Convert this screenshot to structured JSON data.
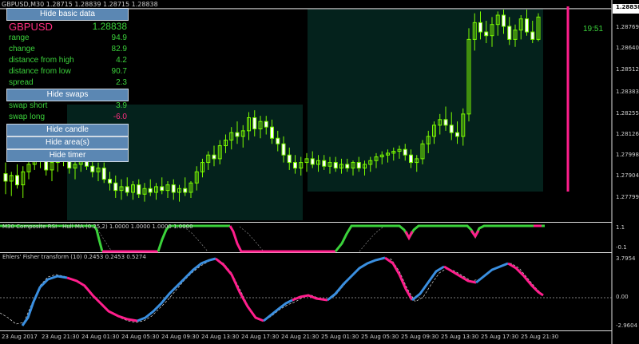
{
  "chart_header": "GBPUSD,M30  1.28715 1.28839 1.28715 1.28838",
  "timer": "19:51",
  "colors": {
    "bull": "#7cfc00",
    "bear": "#ffffff",
    "up_line": "#3a8fe0",
    "down_line": "#ff1e8c",
    "flag": "#ff1e8c",
    "price_box": "#ffffff",
    "box_fill": "#04221c"
  },
  "panel": {
    "hide_basic_label": "Hide basic data",
    "symbol": "GBPUSD",
    "symbol_price": "1.28838",
    "rows": [
      {
        "label": "range",
        "value": "94.9"
      },
      {
        "label": "change",
        "value": "82.9"
      },
      {
        "label": "distance from high",
        "value": "4.2"
      },
      {
        "label": "distance from low",
        "value": "90.7"
      },
      {
        "label": "spread",
        "value": "2.3"
      }
    ],
    "hide_swaps_label": "Hide swaps",
    "swap_short_label": "swap short",
    "swap_short_value": "3.9",
    "swap_long_label": "swap long",
    "swap_long_value": "-6.0",
    "hide_candle_label": "Hide candle",
    "hide_areas_label": "Hide area(s)",
    "hide_timer_label": "Hide timer"
  },
  "price_axis": {
    "current": "1.28838",
    "labels": [
      "1.28769",
      "1.28640",
      "1.28512",
      "1.28383",
      "1.28255",
      "1.28126",
      "1.27998",
      "1.27904",
      "1.27799"
    ]
  },
  "subpanel1": {
    "title": "M30 Composite RSI - Hull MA (0.25,2) 1.0000 1.0000 1.0000 1.0000",
    "levels": [
      "1.1",
      "-0.1"
    ]
  },
  "subpanel2": {
    "title": "Ehlers' Fisher transform (10) 0.2453 0.2453 0.5274",
    "levels": [
      "3.7954",
      "0.00",
      "-2.9604"
    ]
  },
  "time_labels": [
    "23 Aug 2017",
    "23 Aug 21:30",
    "24 Aug 01:30",
    "24 Aug 05:30",
    "24 Aug 09:30",
    "24 Aug 13:30",
    "24 Aug 17:30",
    "24 Aug 21:30",
    "25 Aug 01:30",
    "25 Aug 05:30",
    "25 Aug 09:30",
    "25 Aug 13:30",
    "25 Aug 17:30",
    "25 Aug 21:30"
  ],
  "chart_data": {
    "type": "candlestick",
    "symbol": "GBPUSD",
    "timeframe": "M30",
    "ylim": [
      1.2775,
      1.2888
    ],
    "last_close": 1.28838,
    "candles": [
      {
        "o": 1.28,
        "h": 1.2806,
        "l": 1.2789,
        "c": 1.2796
      },
      {
        "o": 1.2796,
        "h": 1.2801,
        "l": 1.2788,
        "c": 1.2799
      },
      {
        "o": 1.2799,
        "h": 1.2805,
        "l": 1.2792,
        "c": 1.2794
      },
      {
        "o": 1.2794,
        "h": 1.2804,
        "l": 1.2787,
        "c": 1.2801
      },
      {
        "o": 1.2801,
        "h": 1.2811,
        "l": 1.2797,
        "c": 1.2805
      },
      {
        "o": 1.2805,
        "h": 1.2816,
        "l": 1.2802,
        "c": 1.2812
      },
      {
        "o": 1.2812,
        "h": 1.2818,
        "l": 1.2803,
        "c": 1.2808
      },
      {
        "o": 1.2808,
        "h": 1.2812,
        "l": 1.2799,
        "c": 1.2802
      },
      {
        "o": 1.2802,
        "h": 1.2809,
        "l": 1.2796,
        "c": 1.2806
      },
      {
        "o": 1.2806,
        "h": 1.2814,
        "l": 1.2801,
        "c": 1.281
      },
      {
        "o": 1.281,
        "h": 1.2816,
        "l": 1.2804,
        "c": 1.2807
      },
      {
        "o": 1.2807,
        "h": 1.2811,
        "l": 1.28,
        "c": 1.2803
      },
      {
        "o": 1.2803,
        "h": 1.2808,
        "l": 1.2797,
        "c": 1.2805
      },
      {
        "o": 1.2805,
        "h": 1.2811,
        "l": 1.2801,
        "c": 1.2808
      },
      {
        "o": 1.2808,
        "h": 1.2812,
        "l": 1.2802,
        "c": 1.2804
      },
      {
        "o": 1.2804,
        "h": 1.2808,
        "l": 1.2798,
        "c": 1.2801
      },
      {
        "o": 1.2801,
        "h": 1.2806,
        "l": 1.2796,
        "c": 1.2803
      },
      {
        "o": 1.2803,
        "h": 1.2806,
        "l": 1.2795,
        "c": 1.2797
      },
      {
        "o": 1.2797,
        "h": 1.2801,
        "l": 1.2791,
        "c": 1.2795
      },
      {
        "o": 1.2795,
        "h": 1.2799,
        "l": 1.2787,
        "c": 1.2791
      },
      {
        "o": 1.2791,
        "h": 1.2797,
        "l": 1.2786,
        "c": 1.2793
      },
      {
        "o": 1.2793,
        "h": 1.2798,
        "l": 1.2788,
        "c": 1.279
      },
      {
        "o": 1.279,
        "h": 1.2796,
        "l": 1.2786,
        "c": 1.2794
      },
      {
        "o": 1.2794,
        "h": 1.2797,
        "l": 1.2787,
        "c": 1.2789
      },
      {
        "o": 1.2789,
        "h": 1.2795,
        "l": 1.2785,
        "c": 1.2792
      },
      {
        "o": 1.2792,
        "h": 1.2797,
        "l": 1.2788,
        "c": 1.279
      },
      {
        "o": 1.279,
        "h": 1.2795,
        "l": 1.2786,
        "c": 1.2793
      },
      {
        "o": 1.2793,
        "h": 1.2798,
        "l": 1.2789,
        "c": 1.2791
      },
      {
        "o": 1.2791,
        "h": 1.2796,
        "l": 1.2787,
        "c": 1.2794
      },
      {
        "o": 1.2794,
        "h": 1.2797,
        "l": 1.2786,
        "c": 1.279
      },
      {
        "o": 1.279,
        "h": 1.2794,
        "l": 1.2785,
        "c": 1.2792
      },
      {
        "o": 1.2792,
        "h": 1.2798,
        "l": 1.2788,
        "c": 1.279
      },
      {
        "o": 1.279,
        "h": 1.2796,
        "l": 1.2787,
        "c": 1.2795
      },
      {
        "o": 1.2795,
        "h": 1.2804,
        "l": 1.2791,
        "c": 1.2801
      },
      {
        "o": 1.2801,
        "h": 1.2808,
        "l": 1.2798,
        "c": 1.2806
      },
      {
        "o": 1.2806,
        "h": 1.2812,
        "l": 1.2802,
        "c": 1.281
      },
      {
        "o": 1.281,
        "h": 1.2815,
        "l": 1.2804,
        "c": 1.2808
      },
      {
        "o": 1.2808,
        "h": 1.2818,
        "l": 1.2805,
        "c": 1.2815
      },
      {
        "o": 1.2815,
        "h": 1.2821,
        "l": 1.2811,
        "c": 1.2818
      },
      {
        "o": 1.2818,
        "h": 1.2825,
        "l": 1.2813,
        "c": 1.2822
      },
      {
        "o": 1.2822,
        "h": 1.2828,
        "l": 1.2816,
        "c": 1.282
      },
      {
        "o": 1.282,
        "h": 1.2826,
        "l": 1.2814,
        "c": 1.2823
      },
      {
        "o": 1.2823,
        "h": 1.2833,
        "l": 1.2818,
        "c": 1.283
      },
      {
        "o": 1.283,
        "h": 1.2834,
        "l": 1.282,
        "c": 1.2824
      },
      {
        "o": 1.2824,
        "h": 1.2831,
        "l": 1.2819,
        "c": 1.2828
      },
      {
        "o": 1.2828,
        "h": 1.2831,
        "l": 1.2821,
        "c": 1.2825
      },
      {
        "o": 1.2825,
        "h": 1.2829,
        "l": 1.2816,
        "c": 1.2819
      },
      {
        "o": 1.2819,
        "h": 1.2823,
        "l": 1.2812,
        "c": 1.2816
      },
      {
        "o": 1.2816,
        "h": 1.282,
        "l": 1.2806,
        "c": 1.281
      },
      {
        "o": 1.281,
        "h": 1.2814,
        "l": 1.2802,
        "c": 1.2806
      },
      {
        "o": 1.2806,
        "h": 1.281,
        "l": 1.28,
        "c": 1.2803
      },
      {
        "o": 1.2803,
        "h": 1.2809,
        "l": 1.2799,
        "c": 1.2806
      },
      {
        "o": 1.2806,
        "h": 1.2811,
        "l": 1.2801,
        "c": 1.2808
      },
      {
        "o": 1.2808,
        "h": 1.2812,
        "l": 1.2803,
        "c": 1.2805
      },
      {
        "o": 1.2805,
        "h": 1.281,
        "l": 1.2801,
        "c": 1.2807
      },
      {
        "o": 1.2807,
        "h": 1.281,
        "l": 1.2802,
        "c": 1.2804
      },
      {
        "o": 1.2804,
        "h": 1.2809,
        "l": 1.28,
        "c": 1.2806
      },
      {
        "o": 1.2806,
        "h": 1.2809,
        "l": 1.2801,
        "c": 1.2803
      },
      {
        "o": 1.2803,
        "h": 1.2808,
        "l": 1.28,
        "c": 1.2805
      },
      {
        "o": 1.2805,
        "h": 1.2808,
        "l": 1.2801,
        "c": 1.2803
      },
      {
        "o": 1.2803,
        "h": 1.2807,
        "l": 1.2799,
        "c": 1.2806
      },
      {
        "o": 1.2806,
        "h": 1.2809,
        "l": 1.2801,
        "c": 1.2803
      },
      {
        "o": 1.2803,
        "h": 1.2807,
        "l": 1.2799,
        "c": 1.2805
      },
      {
        "o": 1.2805,
        "h": 1.2809,
        "l": 1.2801,
        "c": 1.2807
      },
      {
        "o": 1.2807,
        "h": 1.2811,
        "l": 1.2803,
        "c": 1.2809
      },
      {
        "o": 1.2809,
        "h": 1.2812,
        "l": 1.2805,
        "c": 1.281
      },
      {
        "o": 1.281,
        "h": 1.2813,
        "l": 1.2806,
        "c": 1.2811
      },
      {
        "o": 1.2811,
        "h": 1.2814,
        "l": 1.2807,
        "c": 1.2812
      },
      {
        "o": 1.2812,
        "h": 1.2815,
        "l": 1.2808,
        "c": 1.2813
      },
      {
        "o": 1.2813,
        "h": 1.2816,
        "l": 1.2807,
        "c": 1.281
      },
      {
        "o": 1.281,
        "h": 1.2813,
        "l": 1.2803,
        "c": 1.2806
      },
      {
        "o": 1.2806,
        "h": 1.281,
        "l": 1.2801,
        "c": 1.2808
      },
      {
        "o": 1.2808,
        "h": 1.2818,
        "l": 1.2805,
        "c": 1.2816
      },
      {
        "o": 1.2816,
        "h": 1.2823,
        "l": 1.2811,
        "c": 1.282
      },
      {
        "o": 1.282,
        "h": 1.2828,
        "l": 1.2816,
        "c": 1.2826
      },
      {
        "o": 1.2826,
        "h": 1.2832,
        "l": 1.2821,
        "c": 1.2829
      },
      {
        "o": 1.2829,
        "h": 1.2836,
        "l": 1.2823,
        "c": 1.2826
      },
      {
        "o": 1.2826,
        "h": 1.2833,
        "l": 1.2818,
        "c": 1.2822
      },
      {
        "o": 1.2822,
        "h": 1.2828,
        "l": 1.2816,
        "c": 1.282
      },
      {
        "o": 1.282,
        "h": 1.2835,
        "l": 1.2815,
        "c": 1.2832
      },
      {
        "o": 1.2832,
        "h": 1.2878,
        "l": 1.2828,
        "c": 1.2872
      },
      {
        "o": 1.2872,
        "h": 1.2886,
        "l": 1.2866,
        "c": 1.2881
      },
      {
        "o": 1.2881,
        "h": 1.2887,
        "l": 1.2872,
        "c": 1.2876
      },
      {
        "o": 1.2876,
        "h": 1.2882,
        "l": 1.287,
        "c": 1.2874
      },
      {
        "o": 1.2874,
        "h": 1.2884,
        "l": 1.2868,
        "c": 1.288
      },
      {
        "o": 1.288,
        "h": 1.2887,
        "l": 1.2874,
        "c": 1.2885
      },
      {
        "o": 1.2885,
        "h": 1.2888,
        "l": 1.2875,
        "c": 1.2879
      },
      {
        "o": 1.2879,
        "h": 1.2884,
        "l": 1.2869,
        "c": 1.2872
      },
      {
        "o": 1.2872,
        "h": 1.288,
        "l": 1.2868,
        "c": 1.2877
      },
      {
        "o": 1.2877,
        "h": 1.2885,
        "l": 1.2872,
        "c": 1.2883
      },
      {
        "o": 1.2883,
        "h": 1.2888,
        "l": 1.2874,
        "c": 1.2876
      },
      {
        "o": 1.2876,
        "h": 1.2882,
        "l": 1.287,
        "c": 1.2872
      },
      {
        "o": 1.2872,
        "h": 1.2886,
        "l": 1.2871,
        "c": 1.2884
      }
    ]
  }
}
